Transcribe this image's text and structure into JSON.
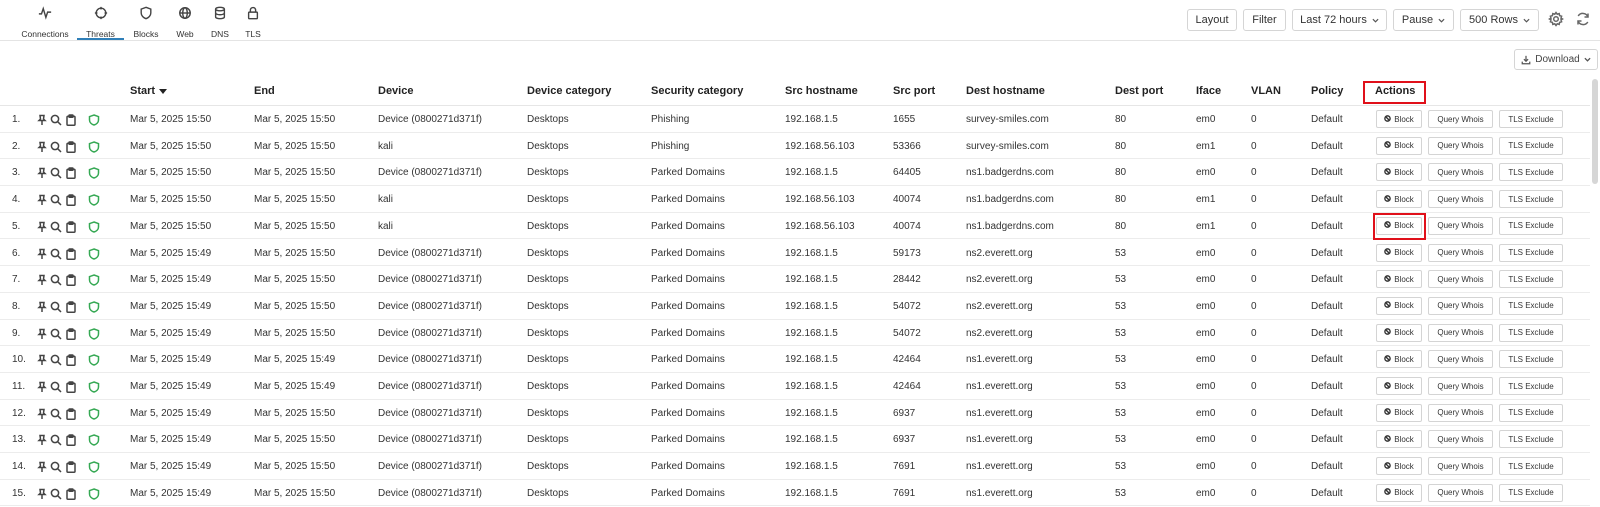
{
  "nav": {
    "tabs": [
      {
        "label": "Connections",
        "icon": "pulse-icon"
      },
      {
        "label": "Threats",
        "icon": "crosshair-icon"
      },
      {
        "label": "Blocks",
        "icon": "shield-icon"
      },
      {
        "label": "Web",
        "icon": "globe-icon"
      },
      {
        "label": "DNS",
        "icon": "database-icon"
      },
      {
        "label": "TLS",
        "icon": "lock-icon"
      }
    ],
    "active_tab": "Threats"
  },
  "toolbar": {
    "layout_label": "Layout",
    "filter_label": "Filter",
    "time_range": "Last 72 hours",
    "pause_label": "Pause",
    "rows_label": "500 Rows"
  },
  "download_label": "Download",
  "table": {
    "columns": [
      "Start",
      "End",
      "Device",
      "Device category",
      "Security category",
      "Src hostname",
      "Src port",
      "Dest hostname",
      "Dest port",
      "Iface",
      "VLAN",
      "Policy",
      "Actions"
    ],
    "sort_column": "Start",
    "action_labels": {
      "block": "Block",
      "whois": "Query Whois",
      "tls": "TLS Exclude"
    },
    "rows": [
      {
        "num": "1.",
        "start": "Mar 5, 2025 15:50",
        "end": "Mar 5, 2025 15:50",
        "device": "Device (0800271d371f)",
        "device_category": "Desktops",
        "security_category": "Phishing",
        "src_hostname": "192.168.1.5",
        "src_port": "1655",
        "dest_hostname": "survey-smiles.com",
        "dest_port": "80",
        "iface": "em0",
        "vlan": "0",
        "policy": "Default"
      },
      {
        "num": "2.",
        "start": "Mar 5, 2025 15:50",
        "end": "Mar 5, 2025 15:50",
        "device": "kali",
        "device_category": "Desktops",
        "security_category": "Phishing",
        "src_hostname": "192.168.56.103",
        "src_port": "53366",
        "dest_hostname": "survey-smiles.com",
        "dest_port": "80",
        "iface": "em1",
        "vlan": "0",
        "policy": "Default"
      },
      {
        "num": "3.",
        "start": "Mar 5, 2025 15:50",
        "end": "Mar 5, 2025 15:50",
        "device": "Device (0800271d371f)",
        "device_category": "Desktops",
        "security_category": "Parked Domains",
        "src_hostname": "192.168.1.5",
        "src_port": "64405",
        "dest_hostname": "ns1.badgerdns.com",
        "dest_port": "80",
        "iface": "em0",
        "vlan": "0",
        "policy": "Default"
      },
      {
        "num": "4.",
        "start": "Mar 5, 2025 15:50",
        "end": "Mar 5, 2025 15:50",
        "device": "kali",
        "device_category": "Desktops",
        "security_category": "Parked Domains",
        "src_hostname": "192.168.56.103",
        "src_port": "40074",
        "dest_hostname": "ns1.badgerdns.com",
        "dest_port": "80",
        "iface": "em1",
        "vlan": "0",
        "policy": "Default"
      },
      {
        "num": "5.",
        "start": "Mar 5, 2025 15:50",
        "end": "Mar 5, 2025 15:50",
        "device": "kali",
        "device_category": "Desktops",
        "security_category": "Parked Domains",
        "src_hostname": "192.168.56.103",
        "src_port": "40074",
        "dest_hostname": "ns1.badgerdns.com",
        "dest_port": "80",
        "iface": "em1",
        "vlan": "0",
        "policy": "Default"
      },
      {
        "num": "6.",
        "start": "Mar 5, 2025 15:49",
        "end": "Mar 5, 2025 15:50",
        "device": "Device (0800271d371f)",
        "device_category": "Desktops",
        "security_category": "Parked Domains",
        "src_hostname": "192.168.1.5",
        "src_port": "59173",
        "dest_hostname": "ns2.everett.org",
        "dest_port": "53",
        "iface": "em0",
        "vlan": "0",
        "policy": "Default"
      },
      {
        "num": "7.",
        "start": "Mar 5, 2025 15:49",
        "end": "Mar 5, 2025 15:50",
        "device": "Device (0800271d371f)",
        "device_category": "Desktops",
        "security_category": "Parked Domains",
        "src_hostname": "192.168.1.5",
        "src_port": "28442",
        "dest_hostname": "ns2.everett.org",
        "dest_port": "53",
        "iface": "em0",
        "vlan": "0",
        "policy": "Default"
      },
      {
        "num": "8.",
        "start": "Mar 5, 2025 15:49",
        "end": "Mar 5, 2025 15:50",
        "device": "Device (0800271d371f)",
        "device_category": "Desktops",
        "security_category": "Parked Domains",
        "src_hostname": "192.168.1.5",
        "src_port": "54072",
        "dest_hostname": "ns2.everett.org",
        "dest_port": "53",
        "iface": "em0",
        "vlan": "0",
        "policy": "Default"
      },
      {
        "num": "9.",
        "start": "Mar 5, 2025 15:49",
        "end": "Mar 5, 2025 15:50",
        "device": "Device (0800271d371f)",
        "device_category": "Desktops",
        "security_category": "Parked Domains",
        "src_hostname": "192.168.1.5",
        "src_port": "54072",
        "dest_hostname": "ns2.everett.org",
        "dest_port": "53",
        "iface": "em0",
        "vlan": "0",
        "policy": "Default"
      },
      {
        "num": "10.",
        "start": "Mar 5, 2025 15:49",
        "end": "Mar 5, 2025 15:49",
        "device": "Device (0800271d371f)",
        "device_category": "Desktops",
        "security_category": "Parked Domains",
        "src_hostname": "192.168.1.5",
        "src_port": "42464",
        "dest_hostname": "ns1.everett.org",
        "dest_port": "53",
        "iface": "em0",
        "vlan": "0",
        "policy": "Default"
      },
      {
        "num": "11.",
        "start": "Mar 5, 2025 15:49",
        "end": "Mar 5, 2025 15:49",
        "device": "Device (0800271d371f)",
        "device_category": "Desktops",
        "security_category": "Parked Domains",
        "src_hostname": "192.168.1.5",
        "src_port": "42464",
        "dest_hostname": "ns1.everett.org",
        "dest_port": "53",
        "iface": "em0",
        "vlan": "0",
        "policy": "Default"
      },
      {
        "num": "12.",
        "start": "Mar 5, 2025 15:49",
        "end": "Mar 5, 2025 15:50",
        "device": "Device (0800271d371f)",
        "device_category": "Desktops",
        "security_category": "Parked Domains",
        "src_hostname": "192.168.1.5",
        "src_port": "6937",
        "dest_hostname": "ns1.everett.org",
        "dest_port": "53",
        "iface": "em0",
        "vlan": "0",
        "policy": "Default"
      },
      {
        "num": "13.",
        "start": "Mar 5, 2025 15:49",
        "end": "Mar 5, 2025 15:50",
        "device": "Device (0800271d371f)",
        "device_category": "Desktops",
        "security_category": "Parked Domains",
        "src_hostname": "192.168.1.5",
        "src_port": "6937",
        "dest_hostname": "ns1.everett.org",
        "dest_port": "53",
        "iface": "em0",
        "vlan": "0",
        "policy": "Default"
      },
      {
        "num": "14.",
        "start": "Mar 5, 2025 15:49",
        "end": "Mar 5, 2025 15:50",
        "device": "Device (0800271d371f)",
        "device_category": "Desktops",
        "security_category": "Parked Domains",
        "src_hostname": "192.168.1.5",
        "src_port": "7691",
        "dest_hostname": "ns1.everett.org",
        "dest_port": "53",
        "iface": "em0",
        "vlan": "0",
        "policy": "Default"
      },
      {
        "num": "15.",
        "start": "Mar 5, 2025 15:49",
        "end": "Mar 5, 2025 15:50",
        "device": "Device (0800271d371f)",
        "device_category": "Desktops",
        "security_category": "Parked Domains",
        "src_hostname": "192.168.1.5",
        "src_port": "7691",
        "dest_hostname": "ns1.everett.org",
        "dest_port": "53",
        "iface": "em0",
        "vlan": "0",
        "policy": "Default"
      }
    ]
  },
  "colors": {
    "accent": "#2f7fb8",
    "highlight": "#e0101a",
    "shield": "#35a853"
  }
}
